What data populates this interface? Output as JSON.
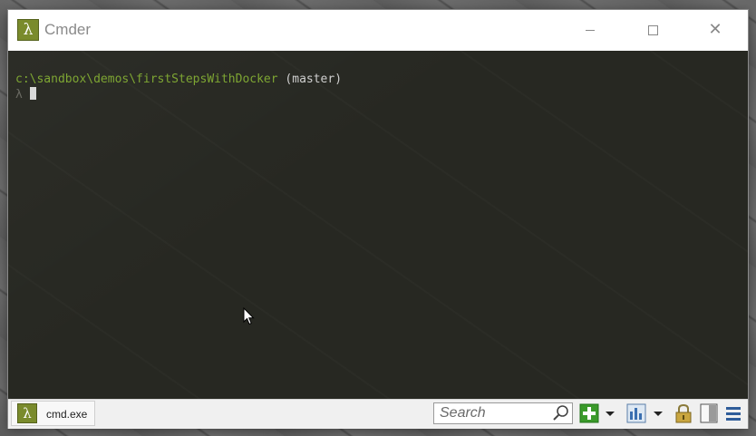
{
  "window": {
    "title": "Cmder",
    "logo_glyph": "λ",
    "controls": {
      "minimize": "minimize",
      "maximize": "maximize",
      "close": "✕"
    }
  },
  "console": {
    "line1_path": "c:\\sandbox\\demos\\firstStepsWithDocker",
    "line1_branch": " (master)",
    "line2_prompt": "λ"
  },
  "statusbar": {
    "tab_logo_glyph": "λ",
    "tab_label": "cmd.exe",
    "search_placeholder": "Search"
  },
  "icons": {
    "add": "add-console-icon",
    "add_dropdown": "dropdown-arrow-icon",
    "view": "view-switch-icon",
    "view_dropdown": "dropdown-arrow-icon",
    "lock": "lock-icon",
    "split": "split-panel-icon",
    "menu": "hamburger-menu-icon"
  },
  "colors": {
    "accent": "#7a8b2c",
    "console_bg": "#272822",
    "path_text": "#7ea633",
    "branch_text": "#cfcfcf"
  }
}
